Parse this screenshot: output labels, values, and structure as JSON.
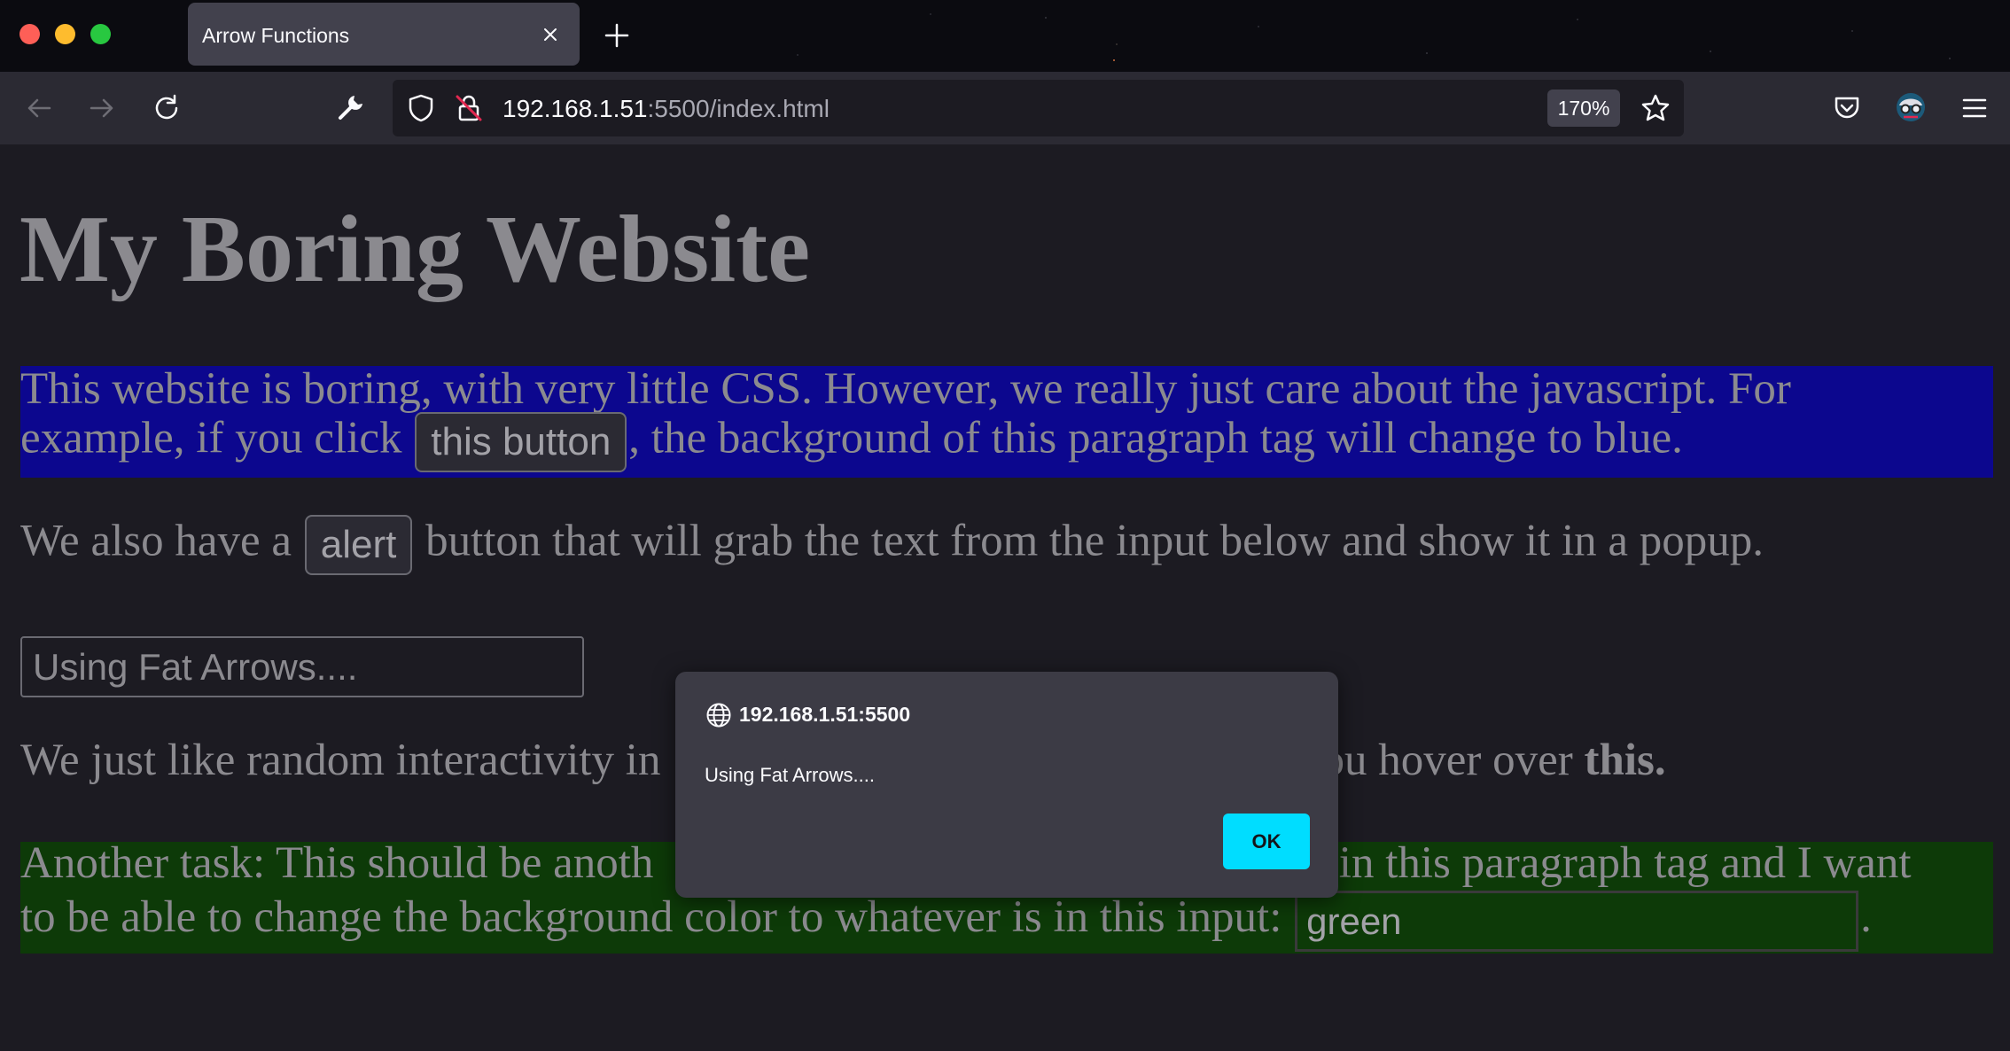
{
  "browser": {
    "tab": {
      "title": "Arrow Functions"
    },
    "address": {
      "host": "192.168.1.51",
      "rest": ":5500/index.html"
    },
    "zoom": "170%",
    "icons": [
      "back-arrow-icon",
      "forward-arrow-icon",
      "reload-icon",
      "wrench-icon",
      "shield-icon",
      "insecure-lock-icon",
      "bookmark-star-icon",
      "pocket-icon",
      "account-avatar-icon",
      "hamburger-menu-icon"
    ]
  },
  "page": {
    "heading": "My Boring Website",
    "p1": {
      "line1": "This website is boring, with very little CSS. However, we really just care about the javascript. For",
      "line2_before": "example, if you click ",
      "button": "this button",
      "line2_after": ", the background of this paragraph tag will change to blue.",
      "background": "#0c078e"
    },
    "p2": {
      "before": "We also have a ",
      "button": "alert",
      "after": " button that will grab the text from the input below and show it in a popup."
    },
    "input_value": "Using Fat Arrows....",
    "p3": {
      "before": "We just like random interactivity in",
      "after": "ou hover over ",
      "bold": "this."
    },
    "p4": {
      "line1_left": "Another task: This should be anoth",
      "line1_right": "e in this paragraph tag and I want",
      "line2_before": "to be able to change the background color to whatever is in this input: ",
      "input_value": "green",
      "line2_after": ".",
      "background": "#0d3a08"
    }
  },
  "dialog": {
    "origin": "192.168.1.51:5500",
    "message": "Using Fat Arrows....",
    "ok_label": "OK",
    "accent": "#00ddff"
  }
}
